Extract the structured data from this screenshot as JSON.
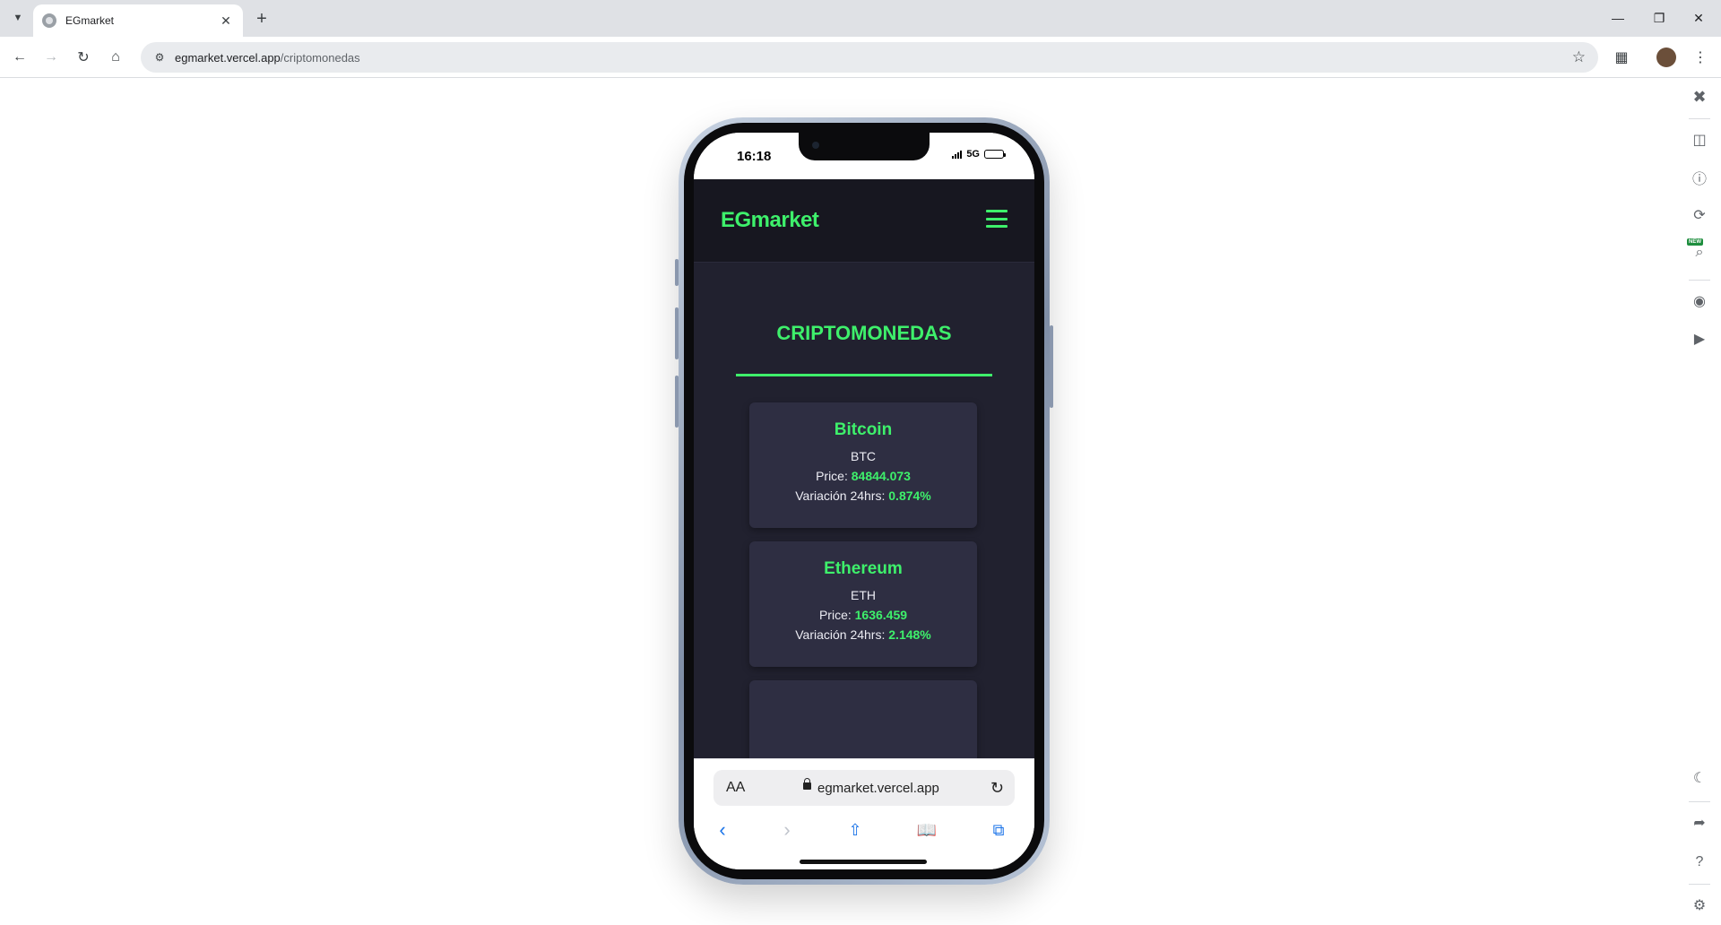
{
  "browser": {
    "tab_title": "EGmarket",
    "url_host": "egmarket.vercel.app",
    "url_path": "/criptomonedas"
  },
  "phone": {
    "time": "16:18",
    "network": "5G"
  },
  "site": {
    "brand": "EGmarket",
    "section_title": "CRIPTOMONEDAS",
    "price_label": "Price:",
    "variation_label": "Variación 24hrs:",
    "coins": [
      {
        "name": "Bitcoin",
        "symbol": "BTC",
        "price": "84844.073",
        "variation": "0.874%"
      },
      {
        "name": "Ethereum",
        "symbol": "ETH",
        "price": "1636.459",
        "variation": "2.148%"
      }
    ]
  },
  "safari": {
    "text_size": "AA",
    "host": "egmarket.vercel.app"
  },
  "colors": {
    "accent": "#3ef06b",
    "page_bg": "#21212f",
    "card_bg": "#2e2e42",
    "header_bg": "#171720"
  },
  "icons": {
    "sidepanel": [
      "close-icon",
      "devices-icon",
      "info-icon",
      "rotate-icon",
      "zoom-icon",
      "camera-icon",
      "video-icon",
      "moon-icon",
      "share-icon",
      "help-icon",
      "settings-icon"
    ]
  }
}
